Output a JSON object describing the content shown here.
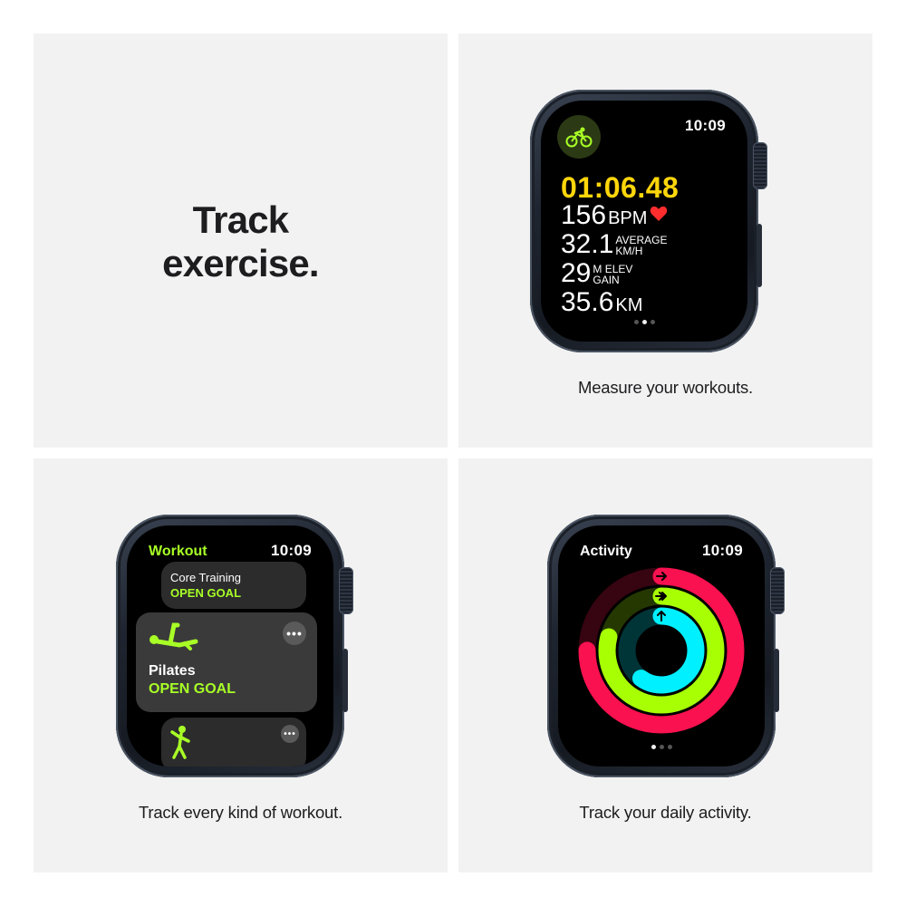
{
  "panels": {
    "headline": {
      "line1": "Track",
      "line2": "exercise."
    },
    "metrics": {
      "caption": "Measure your workouts.",
      "watch": {
        "time": "10:09",
        "elapsed": "01:06.48",
        "heart_rate_value": "156",
        "heart_rate_unit": "BPM",
        "speed_value": "32.1",
        "speed_unit_line1": "AVERAGE",
        "speed_unit_line2": "KM/H",
        "elevation_value": "29",
        "elevation_unit_line1": "M ELEV",
        "elevation_unit_line2": "GAIN",
        "distance_value": "35.6",
        "distance_unit": "KM",
        "page_dots": 3,
        "active_dot": 2
      }
    },
    "workout": {
      "caption": "Track every kind of workout.",
      "watch": {
        "app_title": "Workout",
        "time": "10:09",
        "cards": [
          {
            "name": "Core Training",
            "goal": "OPEN GOAL"
          },
          {
            "name": "Pilates",
            "goal": "OPEN GOAL"
          }
        ],
        "more_label": "•••"
      }
    },
    "activity": {
      "caption": "Track your daily activity.",
      "watch": {
        "app_title": "Activity",
        "time": "10:09",
        "page_dots": 3,
        "active_dot": 1,
        "rings": [
          {
            "name": "move",
            "fraction": 0.75,
            "color": "#fa114f"
          },
          {
            "name": "exercise",
            "fraction": 0.79,
            "color": "#a8ff04"
          },
          {
            "name": "stand",
            "fraction": 0.6,
            "color": "#00f0ff"
          }
        ]
      }
    }
  },
  "colors": {
    "panel_bg": "#f2f2f2",
    "text": "#1d1d1f",
    "accent_yellow": "#ffd60a",
    "accent_green": "#a8ff26",
    "heart_red": "#ff2d2d"
  }
}
